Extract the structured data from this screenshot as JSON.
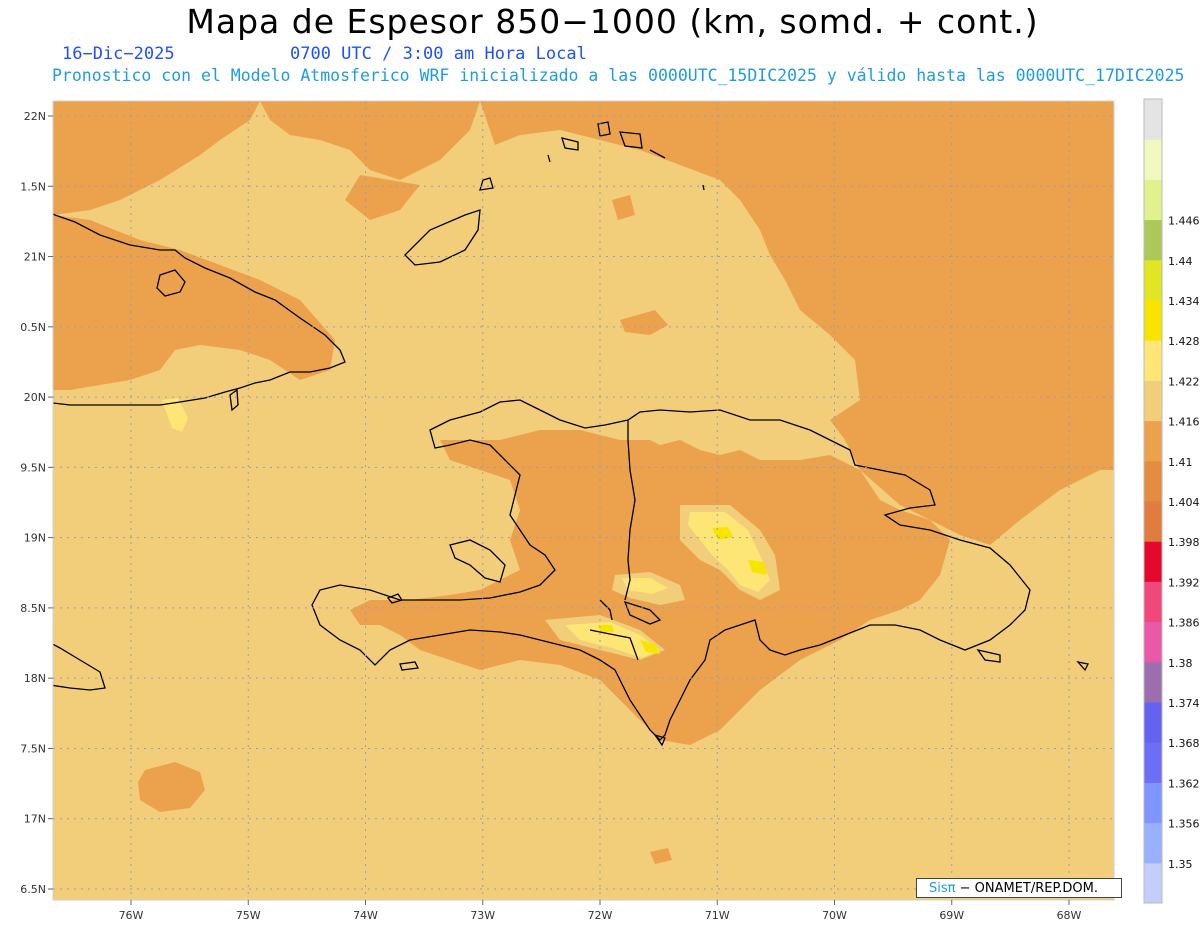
{
  "header": {
    "title": "Mapa de Espesor 850−1000 (km, somd. + cont.)",
    "date": "16−Dic−2025",
    "time": "0700 UTC / 3:00 am Hora Local",
    "subtitle": "Pronostico con el Modelo Atmosferico WRF inicializado a las 0000UTC_15DIC2025 y válido hasta las  0000UTC_17DIC2025"
  },
  "credit": {
    "brand": "Sisπ",
    "org": " − ONAMET/REP.DOM."
  },
  "chart_data": {
    "type": "heatmap",
    "xlim": [
      -76.65,
      -67.6
    ],
    "ylim": [
      17.4,
      22.1
    ],
    "lon_ticks": [
      {
        "value": -76,
        "label": "76W"
      },
      {
        "value": -75,
        "label": "75W"
      },
      {
        "value": -74,
        "label": "74W"
      },
      {
        "value": -73,
        "label": "73W"
      },
      {
        "value": -72,
        "label": "72W"
      },
      {
        "value": -71,
        "label": "71W"
      },
      {
        "value": -70,
        "label": "70W"
      },
      {
        "value": -69,
        "label": "69W"
      },
      {
        "value": -68,
        "label": "68W"
      }
    ],
    "lat_ticks": [
      {
        "value": 22.0,
        "label": "22N"
      },
      {
        "value": 21.5,
        "label": "1.5N"
      },
      {
        "value": 21.0,
        "label": "21N"
      },
      {
        "value": 20.5,
        "label": "0.5N"
      },
      {
        "value": 20.0,
        "label": "20N"
      },
      {
        "value": 19.5,
        "label": "9.5N"
      },
      {
        "value": 19.0,
        "label": "19N"
      },
      {
        "value": 18.5,
        "label": "8.5N"
      },
      {
        "value": 18.0,
        "label": "18N"
      },
      {
        "value": 17.5,
        "label": "7.5N"
      },
      {
        "value": 17.0,
        "label": "17N"
      },
      {
        "value": 16.5,
        "label": "6.5N"
      }
    ],
    "grid": "dotted",
    "colorbar": {
      "levels": [
        "1.35",
        "1.356",
        "1.362",
        "1.368",
        "1.374",
        "1.38",
        "1.386",
        "1.392",
        "1.398",
        "1.404",
        "1.41",
        "1.416",
        "1.422",
        "1.428",
        "1.434",
        "1.44",
        "1.446"
      ],
      "colors": [
        "#c4cdfc",
        "#98b0fe",
        "#7f95ff",
        "#6c6ef5",
        "#6462f0",
        "#9c6eb0",
        "#e85aa8",
        "#f0487c",
        "#e5082e",
        "#e07c3e",
        "#e48d42",
        "#eca24c",
        "#f2cd7a",
        "#fde676",
        "#f7e500",
        "#e2e622",
        "#acc858",
        "#e1f18e",
        "#f1f9c0",
        "#e4e4e4"
      ],
      "position": "right"
    },
    "field_colors": {
      "1.398-1.404": "#eca24c",
      "1.404-1.41": "#f2cd7a",
      "1.41-1.416": "#fde676",
      "1.416-1.422": "#f7e500",
      "1.392-1.398": "#e48d42"
    },
    "coastline_color": "#000000"
  }
}
